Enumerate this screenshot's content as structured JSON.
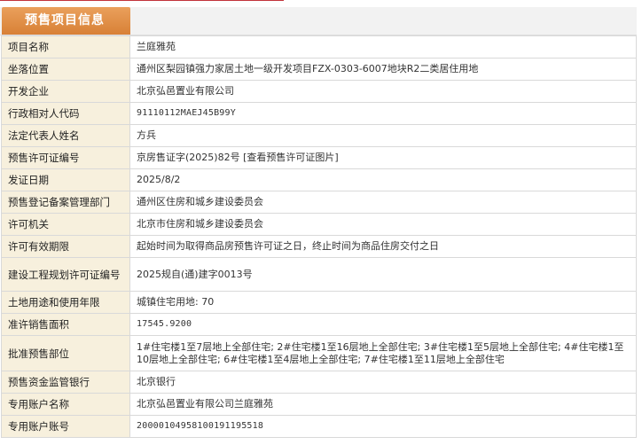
{
  "header": {
    "tab_title": "预售项目信息"
  },
  "rows": [
    {
      "label": "项目名称",
      "value": "兰庭雅苑"
    },
    {
      "label": "坐落位置",
      "value": "通州区梨园镇强力家居土地一级开发项目FZX-0303-6007地块R2二类居住用地"
    },
    {
      "label": "开发企业",
      "value": "北京弘邑置业有限公司"
    },
    {
      "label": "行政相对人代码",
      "value": "91110112MAEJ45B99Y"
    },
    {
      "label": "法定代表人姓名",
      "value": "方兵"
    },
    {
      "label": "预售许可证编号",
      "value": "京房售证字(2025)82号",
      "link_text": "[查看预售许可证图片]"
    },
    {
      "label": "发证日期",
      "value": "2025/8/2"
    },
    {
      "label": "预售登记备案管理部门",
      "value": "通州区住房和城乡建设委员会"
    },
    {
      "label": "许可机关",
      "value": "北京市住房和城乡建设委员会"
    },
    {
      "label": "许可有效期限",
      "value": "起始时间为取得商品房预售许可证之日，终止时间为商品住房交付之日"
    },
    {
      "label": "建设工程规划许可证编号",
      "value": "2025规自(通)建字0013号"
    },
    {
      "label": "土地用途和使用年限",
      "value": "城镇住宅用地: 70"
    },
    {
      "label": "准许销售面积",
      "value": "17545.9200"
    },
    {
      "label": "批准预售部位",
      "value": "1#住宅楼1至7层地上全部住宅; 2#住宅楼1至16层地上全部住宅; 3#住宅楼1至5层地上全部住宅; 4#住宅楼1至10层地上全部住宅; 6#住宅楼1至4层地上全部住宅; 7#住宅楼1至11层地上全部住宅"
    },
    {
      "label": "预售资金监管银行",
      "value": "北京银行"
    },
    {
      "label": "专用账户名称",
      "value": "北京弘邑置业有限公司兰庭雅苑"
    },
    {
      "label": "专用账户账号",
      "value": "20000104958100191195518"
    }
  ]
}
